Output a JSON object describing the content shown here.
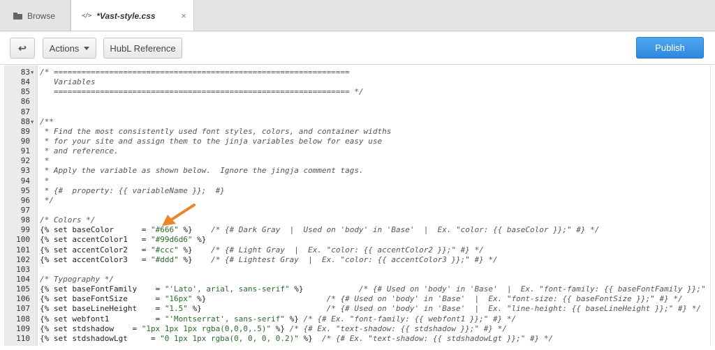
{
  "tabs": [
    {
      "label": "Browse",
      "icon": "folder-icon"
    },
    {
      "label": "*Vast-style.css",
      "icon": "code-icon",
      "close": "×"
    }
  ],
  "toolbar": {
    "back_icon": "↩",
    "actions_label": "Actions",
    "hubl_label": "HubL Reference",
    "publish_label": "Publish"
  },
  "colors": {
    "accent": "#2e86dc",
    "arrow": "#e8862a",
    "string": "#2a6b2a"
  },
  "editor": {
    "lines": [
      {
        "n": "83",
        "fold": true,
        "text": "/* ================================================================",
        "kind": "comment"
      },
      {
        "n": "84",
        "text": "   Variables",
        "kind": "comment"
      },
      {
        "n": "85",
        "text": "   ================================================================ */",
        "kind": "comment"
      },
      {
        "n": "86",
        "text": "",
        "kind": "plain"
      },
      {
        "n": "87",
        "text": "",
        "kind": "plain"
      },
      {
        "n": "88",
        "fold": true,
        "text": "/**",
        "kind": "comment"
      },
      {
        "n": "89",
        "text": " * Find the most consistently used font styles, colors, and container widths",
        "kind": "comment"
      },
      {
        "n": "90",
        "text": " * for your site and assign them to the jinja variables below for easy use",
        "kind": "comment"
      },
      {
        "n": "91",
        "text": " * and reference.",
        "kind": "comment"
      },
      {
        "n": "92",
        "text": " *",
        "kind": "comment"
      },
      {
        "n": "93",
        "text": " * Apply the variable as shown below.  Ignore the jingja comment tags.",
        "kind": "comment"
      },
      {
        "n": "94",
        "text": " *",
        "kind": "comment"
      },
      {
        "n": "95",
        "text": " * {#  property: {{ variableName }};  #}",
        "kind": "comment"
      },
      {
        "n": "96",
        "text": " */",
        "kind": "comment"
      },
      {
        "n": "97",
        "text": "",
        "kind": "plain"
      },
      {
        "n": "98",
        "text": "/* Colors */",
        "kind": "comment"
      },
      {
        "n": "99",
        "pre": "{% set baseColor      = ",
        "str": "\"#666\"",
        "post": " %}",
        "cm": "    /* {# Dark Gray  |  Used on 'body' in 'Base'  |  Ex. \"color: {{ baseColor }};\" #} */",
        "kind": "set"
      },
      {
        "n": "100",
        "pre": "{% set accentColor1   = ",
        "str": "\"#99d6d6\"",
        "post": " %}",
        "cm": "",
        "kind": "set"
      },
      {
        "n": "101",
        "pre": "{% set accentColor2   = ",
        "str": "\"#ccc\"",
        "post": " %}",
        "cm": "    /* {# Light Gray  |  Ex. \"color: {{ accentColor2 }};\" #} */",
        "kind": "set"
      },
      {
        "n": "102",
        "pre": "{% set accentColor3   = ",
        "str": "\"#ddd\"",
        "post": " %}",
        "cm": "    /* {# Lightest Gray  |  Ex. \"color: {{ accentColor3 }};\" #} */",
        "kind": "set"
      },
      {
        "n": "103",
        "text": "",
        "kind": "plain"
      },
      {
        "n": "104",
        "text": "/* Typography */",
        "kind": "comment"
      },
      {
        "n": "105",
        "pre": "{% set baseFontFamily    = ",
        "str": "\"'Lato', arial, sans-serif\"",
        "post": " %}",
        "cm": "            /* {# Used on 'body' in 'Base'  |  Ex. \"font-family: {{ baseFontFamily }};\" #} */",
        "kind": "set"
      },
      {
        "n": "106",
        "pre": "{% set baseFontSize      = ",
        "str": "\"16px\"",
        "post": " %}",
        "cm": "                          /* {# Used on 'body' in 'Base'  |  Ex. \"font-size: {{ baseFontSize }};\" #} */",
        "kind": "set"
      },
      {
        "n": "107",
        "pre": "{% set baseLineHeight    = ",
        "str": "\"1.5\"",
        "post": " %}",
        "cm": "                           /* {# Used on 'body' in 'Base'  |  Ex. \"line-height: {{ baseLineHeight }};\" #} */",
        "kind": "set"
      },
      {
        "n": "108",
        "pre": "{% set webfont1          = ",
        "str": "\"'Montserrat', sans-serif\"",
        "post": " %}",
        "cm": " /* {# Ex. \"font-family: {{ webfont1 }};\" #} */",
        "kind": "set"
      },
      {
        "n": "109",
        "pre": "{% set stdshadow    = ",
        "str": "\"1px 1px 1px rgba(0,0,0,.5)\"",
        "post": " %}",
        "cm": " /* {# Ex. \"text-shadow: {{ stdshadow }};\" #} */",
        "kind": "set"
      },
      {
        "n": "110",
        "pre": "{% set stdshadowLgt     = ",
        "str": "\"0 1px 1px rgba(0, 0, 0, 0.2)\"",
        "post": " %}",
        "cm": "  /* {# Ex. \"text-shadow: {{ stdshadowLgt }};\" #} */",
        "kind": "set"
      }
    ]
  }
}
